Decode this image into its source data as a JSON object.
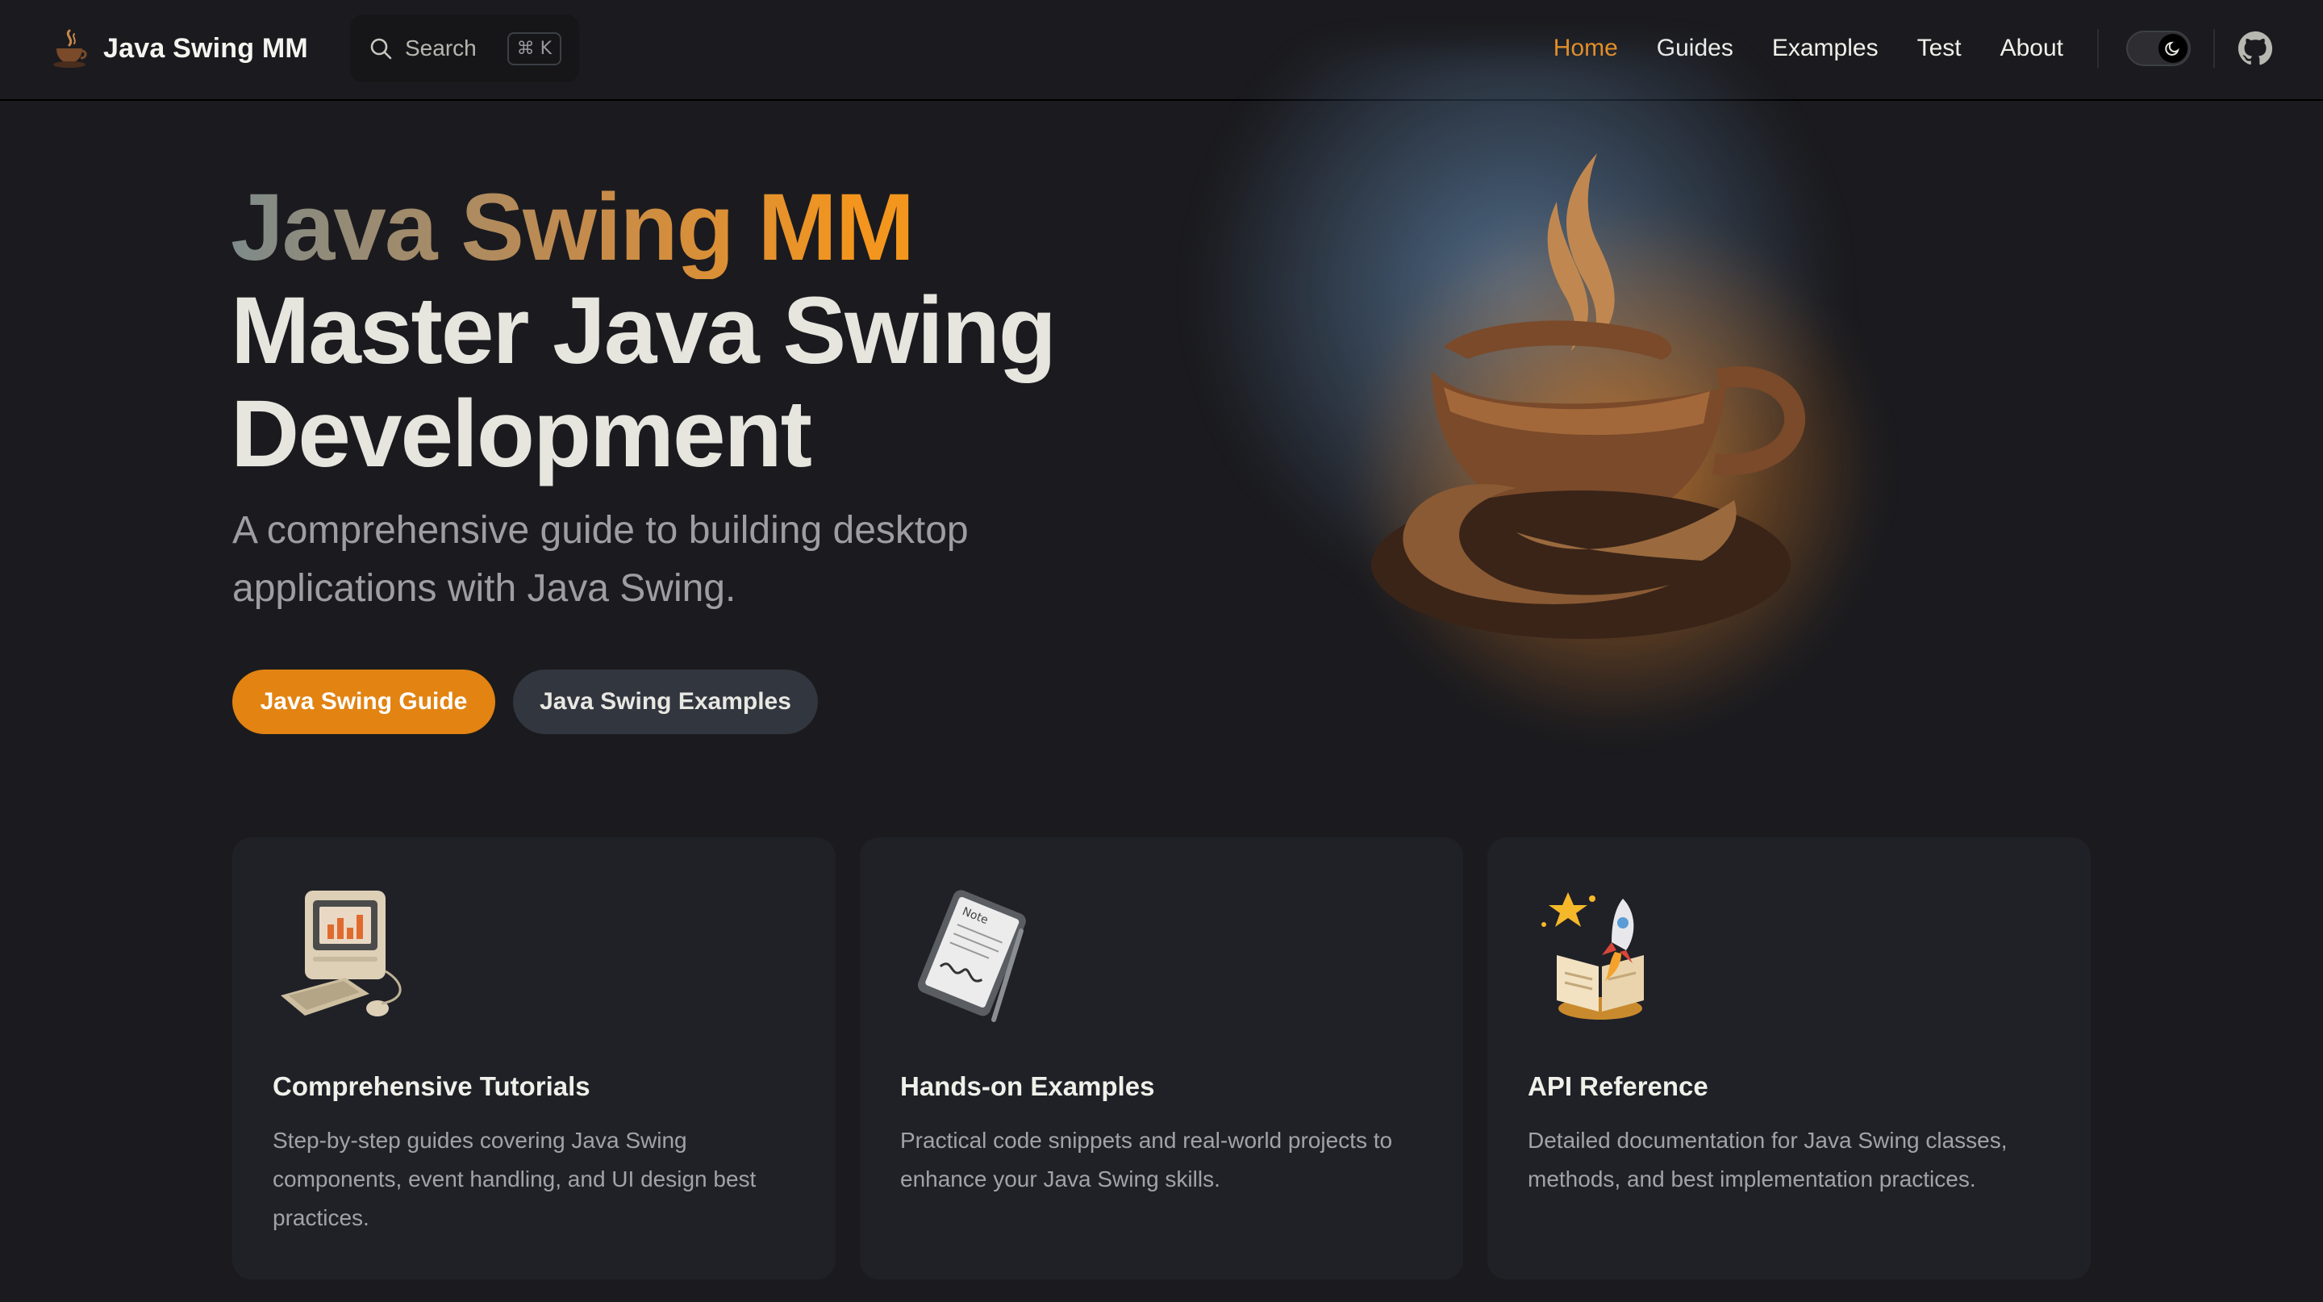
{
  "nav": {
    "brand_title": "Java Swing MM",
    "logo_icon": "coffee-cup-icon",
    "search_label": "Search",
    "search_shortcut": "⌘ K",
    "items": [
      {
        "label": "Home",
        "active": true
      },
      {
        "label": "Guides",
        "active": false
      },
      {
        "label": "Examples",
        "active": false
      },
      {
        "label": "Test",
        "active": false
      },
      {
        "label": "About",
        "active": false
      }
    ],
    "theme_toggle_icon": "moon-icon",
    "social_icon": "github-icon"
  },
  "hero": {
    "name": "Java Swing MM",
    "text": "Master Java Swing Development",
    "tagline": "A comprehensive guide to building desktop applications with Java Swing.",
    "image_icon": "coffee-cup-icon",
    "actions": [
      {
        "label": "Java Swing Guide",
        "style": "brand"
      },
      {
        "label": "Java Swing Examples",
        "style": "alt"
      }
    ]
  },
  "features": [
    {
      "icon": "retro-computer-icon",
      "title": "Comprehensive Tutorials",
      "details": "Step-by-step guides covering Java Swing components, event handling, and UI design best practices."
    },
    {
      "icon": "note-tablet-icon",
      "title": "Hands-on Examples",
      "details": "Practical code snippets and real-world projects to enhance your Java Swing skills."
    },
    {
      "icon": "book-rocket-icon",
      "title": "API Reference",
      "details": "Detailed documentation for Java Swing classes, methods, and best implementation practices."
    }
  ],
  "colors": {
    "brand": "#e28312",
    "background": "#1b1b1f",
    "card": "#202127",
    "active_nav": "#f08f1c"
  }
}
